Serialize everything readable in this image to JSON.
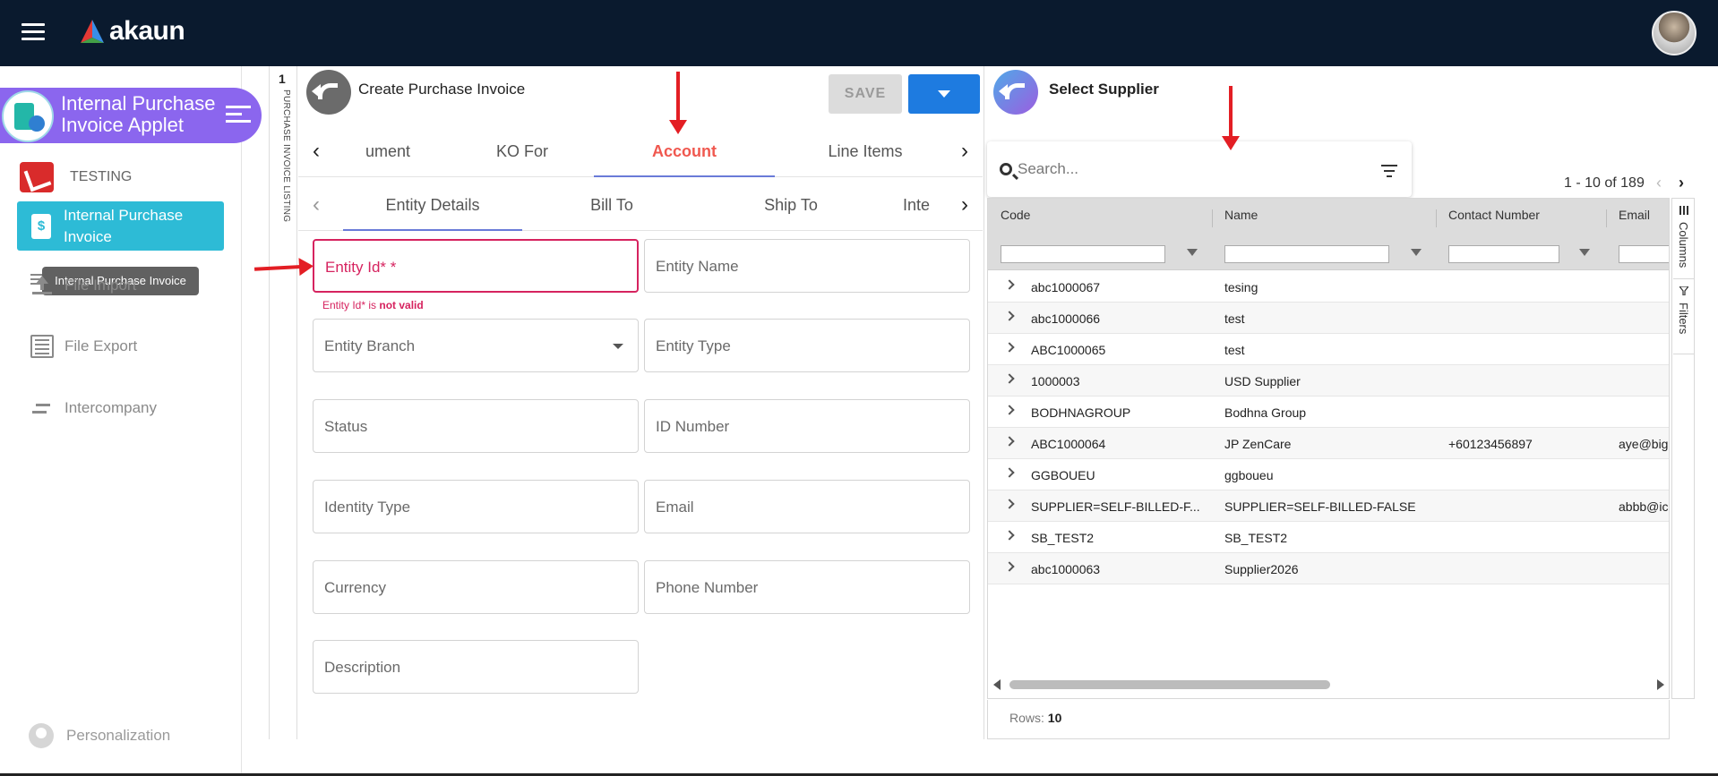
{
  "app": {
    "brand": "akaun"
  },
  "sidebar": {
    "applet_title": "Internal Purchase Invoice Applet",
    "org": "TESTING",
    "active_item": "Internal Purchase Invoice",
    "tooltip": "Internal Purchase Invoice",
    "items": [
      {
        "label": "File Import",
        "icon": "upload-icon"
      },
      {
        "label": "File Export",
        "icon": "list-icon"
      },
      {
        "label": "Intercompany",
        "icon": "transfer-icon"
      }
    ],
    "personalization": "Personalization"
  },
  "listing_strip": {
    "number": "1",
    "label": "PURCHASE INVOICE LISTING"
  },
  "invoice_panel": {
    "title": "Create Purchase Invoice",
    "save_label": "SAVE",
    "tabs": [
      "ument",
      "KO For",
      "Account",
      "Line Items"
    ],
    "active_tab": "Account",
    "subtabs": [
      "Entity Details",
      "Bill To",
      "Ship To",
      "Inte"
    ],
    "fields": {
      "entity_id": "Entity Id* *",
      "entity_name": "Entity Name",
      "entity_branch": "Entity Branch",
      "entity_type": "Entity Type",
      "status": "Status",
      "id_number": "ID Number",
      "identity_type": "Identity Type",
      "email": "Email",
      "currency": "Currency",
      "phone_number": "Phone Number",
      "description": "Description"
    },
    "error": {
      "prefix": "Entity Id* is ",
      "strong": "not valid"
    }
  },
  "supplier_panel": {
    "title": "Select Supplier",
    "search_placeholder": "Search...",
    "pager": "1 - 10 of 189",
    "columns": [
      "Code",
      "Name",
      "Contact Number",
      "Email"
    ],
    "rows": [
      {
        "code": "abc1000067",
        "name": "tesing",
        "contact": "",
        "email": ""
      },
      {
        "code": "abc1000066",
        "name": "test",
        "contact": "",
        "email": ""
      },
      {
        "code": "ABC1000065",
        "name": "test",
        "contact": "",
        "email": ""
      },
      {
        "code": "1000003",
        "name": "USD Supplier",
        "contact": "",
        "email": ""
      },
      {
        "code": "BODHNAGROUP",
        "name": "Bodhna Group",
        "contact": "",
        "email": ""
      },
      {
        "code": "ABC1000064",
        "name": "JP ZenCare",
        "contact": "+60123456897",
        "email": "aye@bigl"
      },
      {
        "code": "GGBOUEU",
        "name": "ggboueu",
        "contact": "",
        "email": ""
      },
      {
        "code": "SUPPLIER=SELF-BILLED-F...",
        "name": "SUPPLIER=SELF-BILLED-FALSE",
        "contact": "",
        "email": "abbb@ic"
      },
      {
        "code": "SB_TEST2",
        "name": "SB_TEST2",
        "contact": "",
        "email": ""
      },
      {
        "code": "abc1000063",
        "name": "Supplier2026",
        "contact": "",
        "email": ""
      }
    ],
    "rows_label": "Rows:",
    "rows_count": "10",
    "side_tools": [
      "Columns",
      "Filters"
    ]
  },
  "colors": {
    "topbar": "#0a1a2e",
    "applet_purple": "#8b66ee",
    "active_nav": "#2dbbd6",
    "primary_blue": "#1e7be0",
    "error": "#d6235f",
    "tab_active": "#f0584f",
    "annotation_red": "#e31e24"
  }
}
